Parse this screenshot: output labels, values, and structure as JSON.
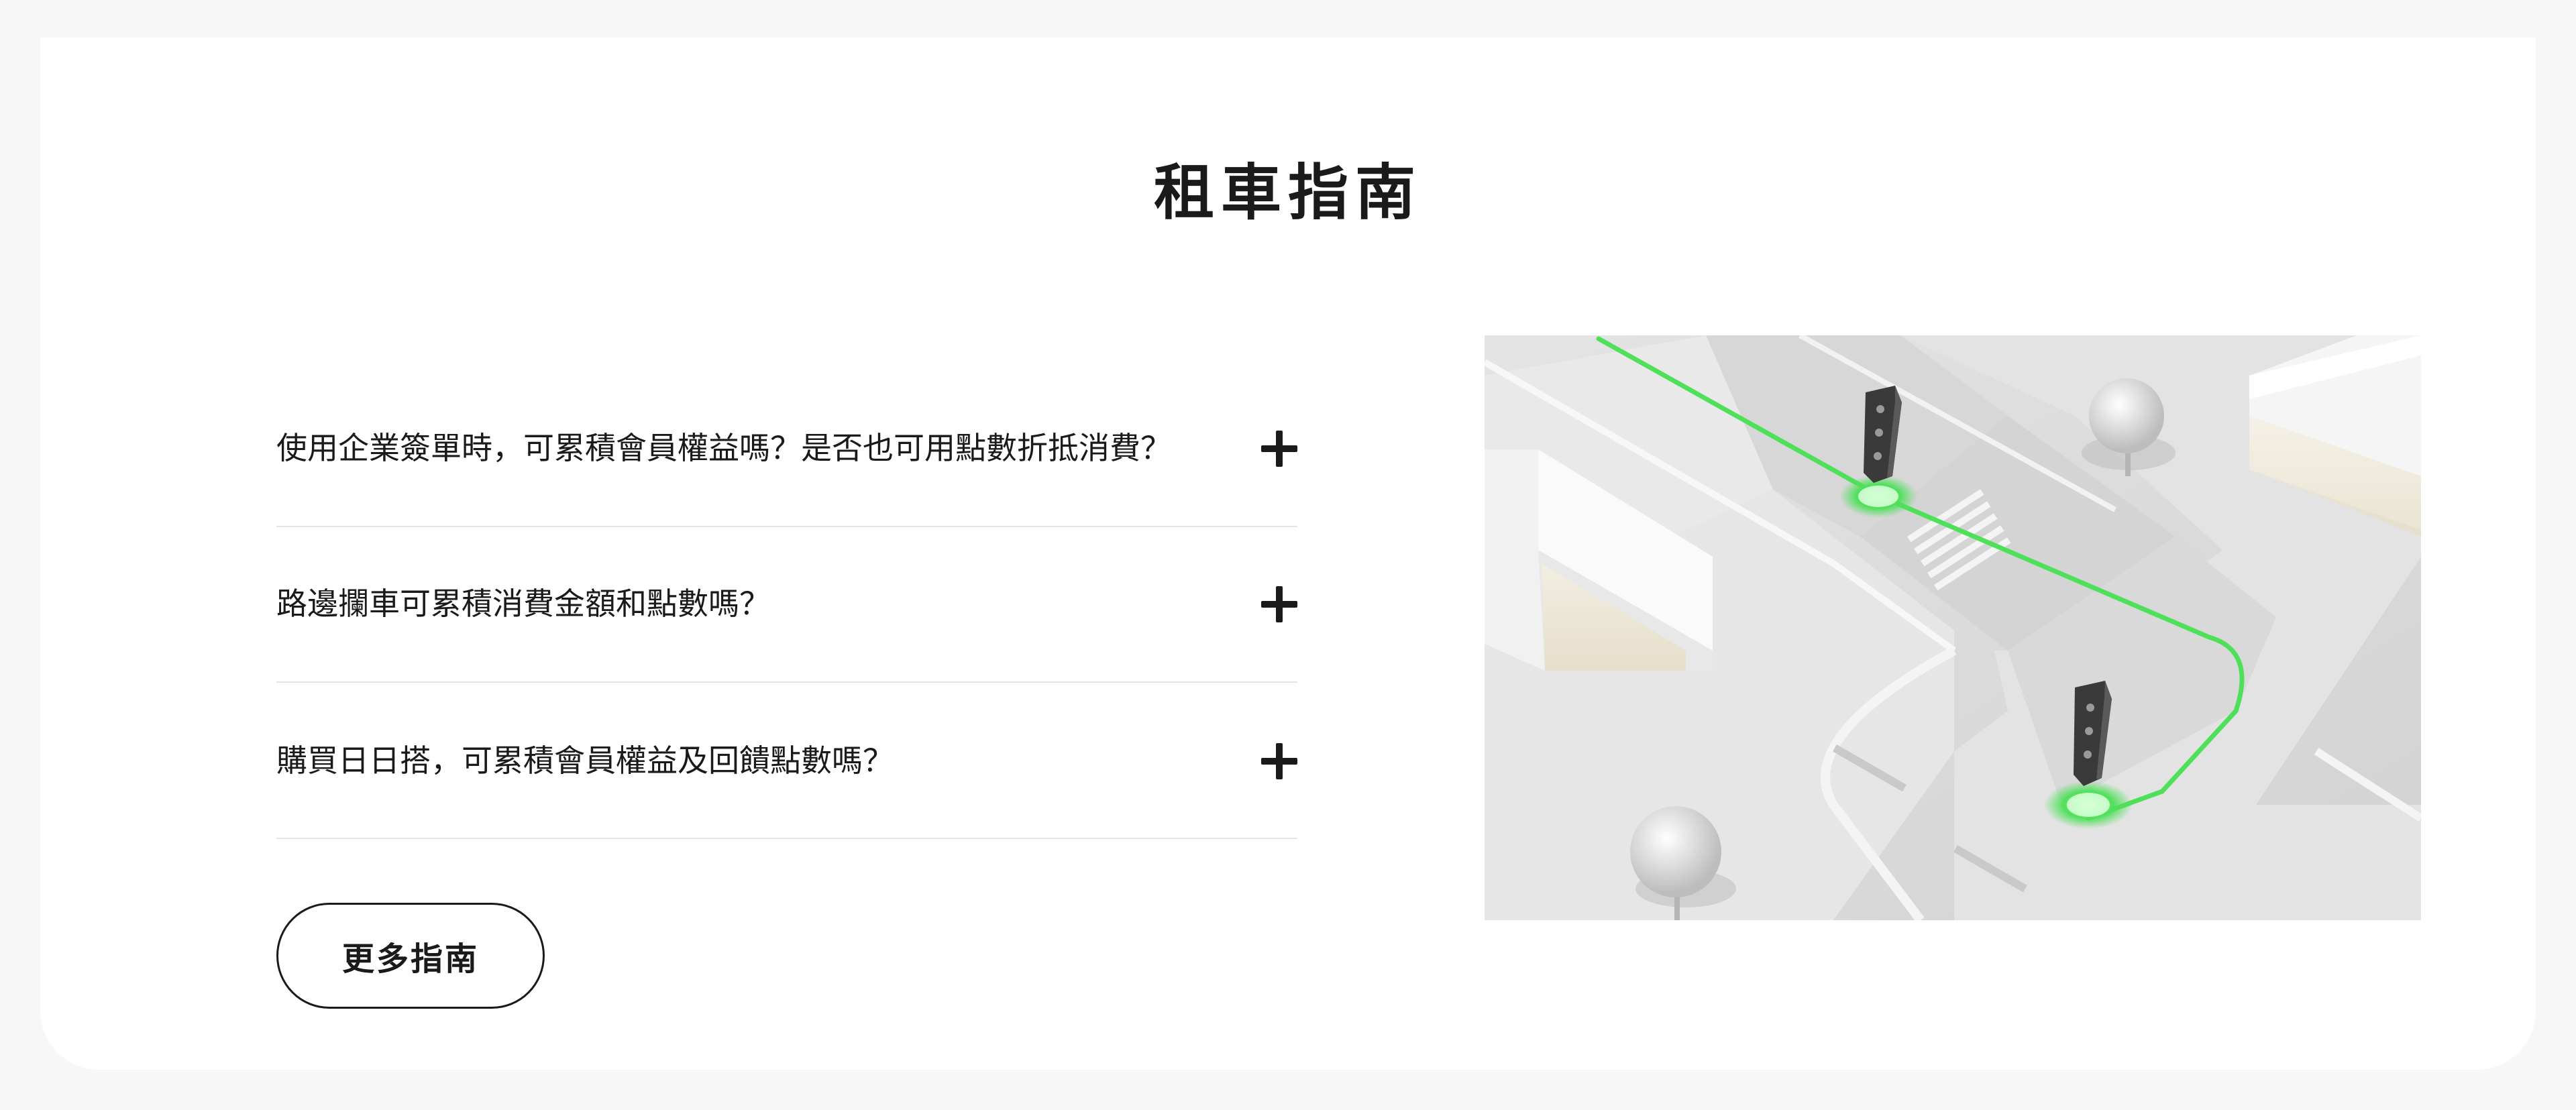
{
  "section": {
    "title": "租車指南"
  },
  "faq": {
    "items": [
      {
        "question": "使用企業簽單時，可累積會員權益嗎？是否也可用點數折抵消費？"
      },
      {
        "question": "路邊攔車可累積消費金額和點數嗎？"
      },
      {
        "question": "購買日日搭，可累積會員權益及回饋點數嗎？"
      }
    ]
  },
  "more_button": {
    "label": "更多指南"
  },
  "illustration": {
    "accent_color": "#4fe05a",
    "background_color": "#dcdcdc"
  }
}
